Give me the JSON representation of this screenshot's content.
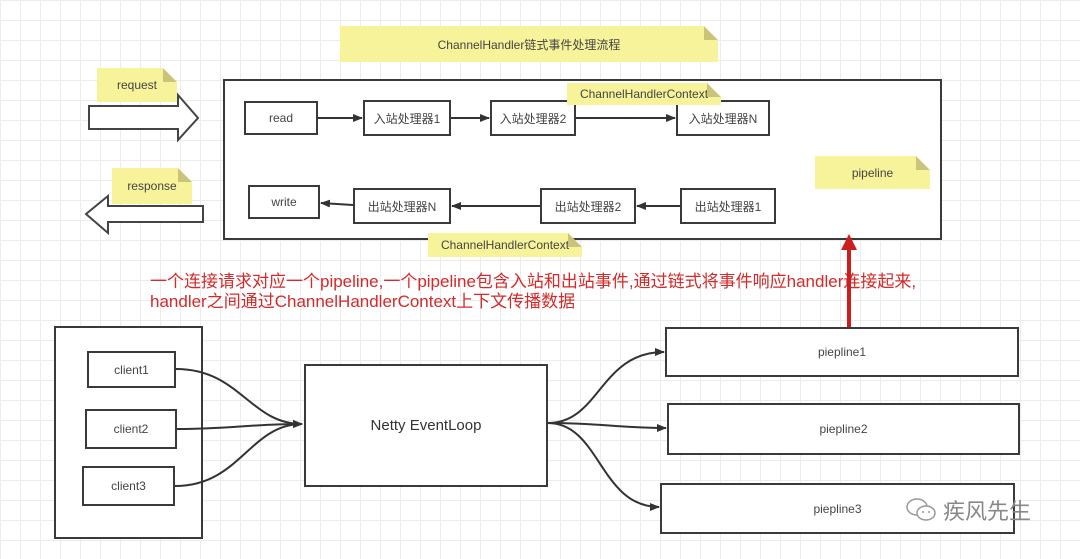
{
  "title_note": "ChannelHandler链式事件处理流程",
  "request_note": "request",
  "response_note": "response",
  "pipeline_note": "pipeline",
  "context_notes": [
    "ChannelHandlerContext",
    "ChannelHandlerContext"
  ],
  "inbound": {
    "start": "read",
    "handlers": [
      "入站处理器1",
      "入站处理器2",
      "入站处理器N"
    ]
  },
  "outbound": {
    "end": "write",
    "handlers": [
      "出站处理器N",
      "出站处理器2",
      "出站处理器1"
    ]
  },
  "annotation": {
    "line1": "一个连接请求对应一个pipeline,一个pipeline包含入站和出站事件,通过链式将事件响应handler连接起来,",
    "line2": "handler之间通过ChannelHandlerContext上下文传播数据",
    "color": "#d22b2b"
  },
  "clients": [
    "client1",
    "client2",
    "client3"
  ],
  "event_loop": "Netty EventLoop",
  "pipelines": [
    "piepline1",
    "piepline2",
    "piepline3"
  ],
  "watermark": "疾风先生"
}
